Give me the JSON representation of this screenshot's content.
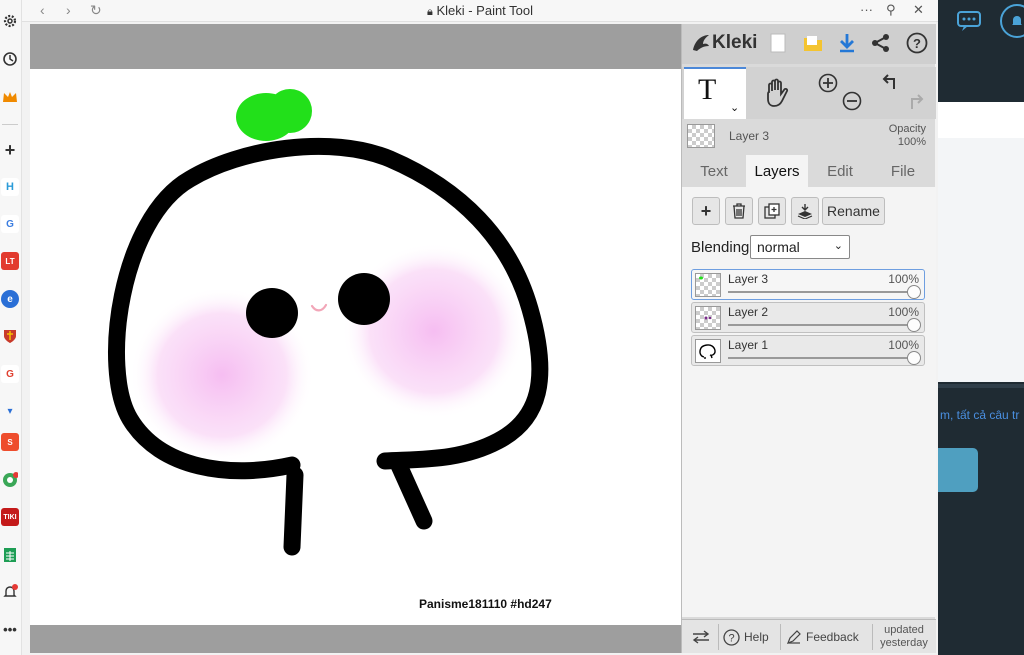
{
  "browser": {
    "title": "Kleki - Paint Tool",
    "sidebar_icons": [
      "settings-icon",
      "history-icon",
      "crown-icon",
      "add-icon",
      "h-app-icon",
      "google-icon",
      "lt-app-icon",
      "edge-app-icon",
      "shield-app-icon",
      "google-icon-2",
      "download-app-icon",
      "shopee-app-icon",
      "chrome-icon",
      "tiki-app-icon",
      "sheets-app-icon",
      "bell-icon",
      "more-icon"
    ]
  },
  "kleki": {
    "logo": "Kleki",
    "layer_info": {
      "name": "Layer 3",
      "opacity_label": "Opacity",
      "opacity_value": "100%"
    },
    "tabs": [
      "Text",
      "Layers",
      "Edit",
      "File"
    ],
    "active_tab": "Layers",
    "layer_buttons": {
      "rename": "Rename"
    },
    "blending": {
      "label": "Blending",
      "value": "normal"
    },
    "layers": [
      {
        "name": "Layer 3",
        "opacity": "100%",
        "selected": true
      },
      {
        "name": "Layer 2",
        "opacity": "100%",
        "selected": false
      },
      {
        "name": "Layer 1",
        "opacity": "100%",
        "selected": false
      }
    ],
    "bottom": {
      "help": "Help",
      "feedback": "Feedback",
      "updated_line1": "updated",
      "updated_line2": "yesterday"
    }
  },
  "canvas": {
    "signature": "Panisme181110 #hd247"
  },
  "background_page": {
    "snippet": "m, tất cả câu tr"
  },
  "colors": {
    "accent_blue": "#4c88d8",
    "sprout_green": "#22e01a",
    "blush_pink": "#f5b6f0"
  }
}
